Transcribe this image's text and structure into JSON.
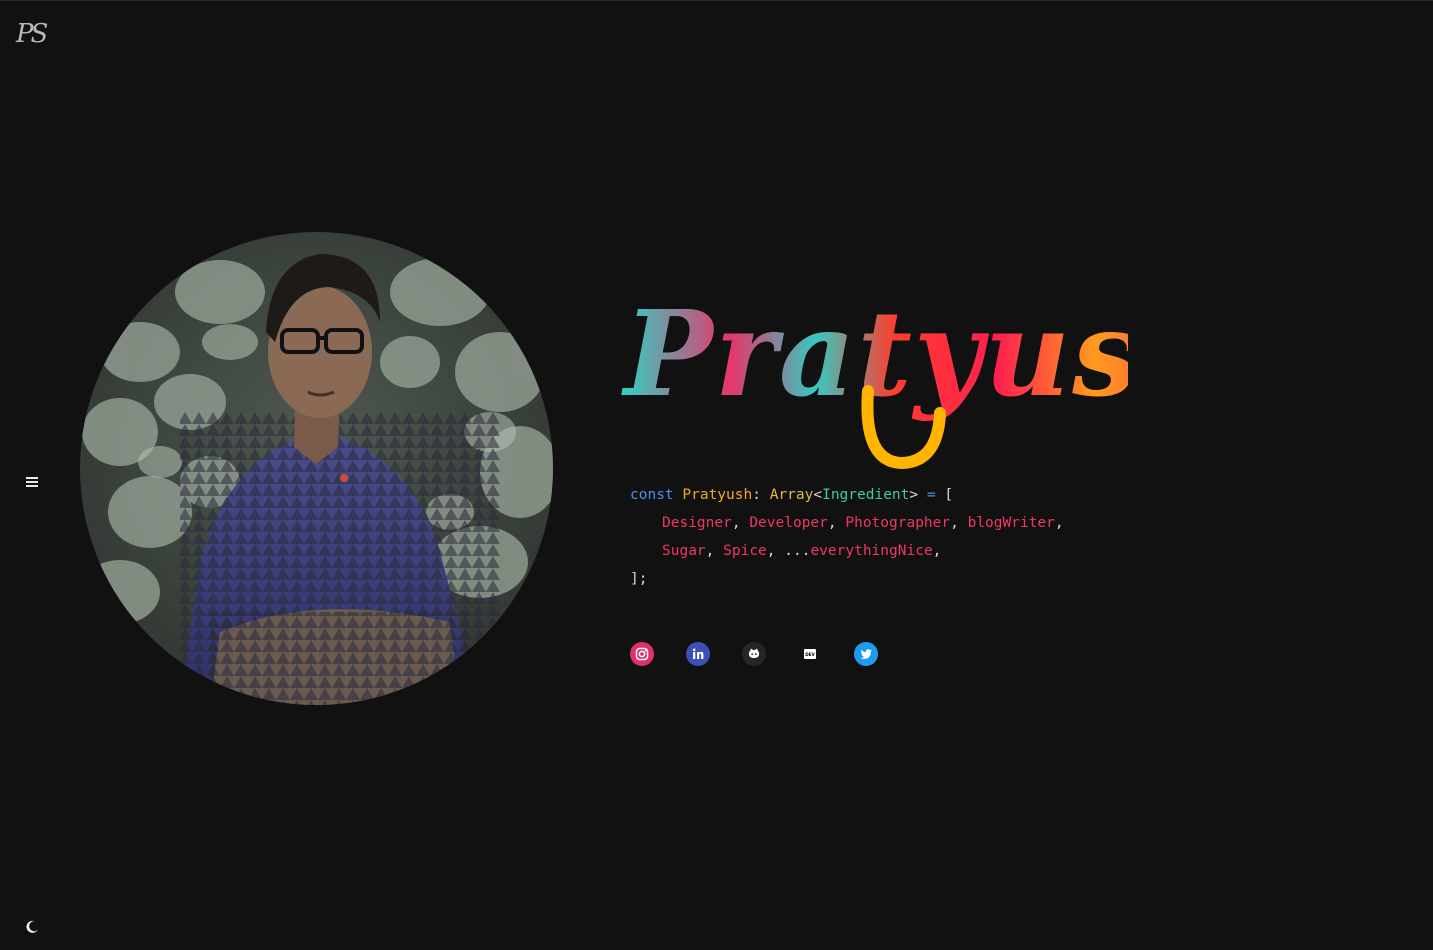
{
  "logo": {
    "text": "PS"
  },
  "hero": {
    "name": "Pratyush"
  },
  "code": {
    "keyword": "const",
    "identifier": "Pratyush",
    "colon": ":",
    "type": "Array",
    "lt": "<",
    "generic": "Ingredient",
    "gt": ">",
    "assign": "=",
    "open": "[",
    "line2": [
      {
        "text": "Designer"
      },
      {
        "text": "Developer"
      },
      {
        "text": "Photographer"
      },
      {
        "text": "blogWriter"
      }
    ],
    "line3": [
      {
        "text": "Sugar"
      },
      {
        "text": "Spice"
      }
    ],
    "spread": "...",
    "spread_name": "everythingNice",
    "close": "];"
  },
  "socials": [
    {
      "name": "instagram",
      "icon": "instagram-icon",
      "color": "#e1306c"
    },
    {
      "name": "linkedin",
      "icon": "linkedin-icon",
      "color": "#3b4fb4"
    },
    {
      "name": "github",
      "icon": "github-icon",
      "color": "#262626"
    },
    {
      "name": "dev",
      "icon": "dev-icon",
      "label": "DEV",
      "color": "#000000"
    },
    {
      "name": "twitter",
      "icon": "twitter-icon",
      "color": "#1d9bf0"
    }
  ],
  "colors": {
    "background": "#111111",
    "keyword": "#4d8ff0",
    "identifier": "#f5a623",
    "generic": "#3fcf8e",
    "string": "#f0385f"
  }
}
